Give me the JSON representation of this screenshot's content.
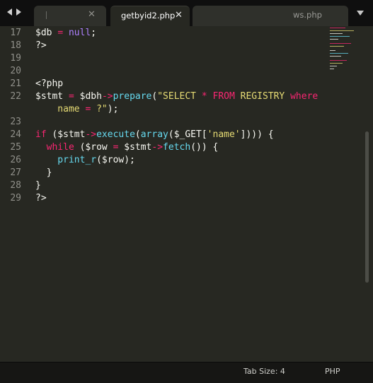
{
  "tabs": [
    {
      "label": "",
      "active": false
    },
    {
      "label": "getbyid2.php",
      "active": true
    },
    {
      "label": "ws.php",
      "active": false
    }
  ],
  "tab_close_glyph": "✕",
  "icons": [
    "nav-back-icon",
    "nav-forward-icon",
    "close-icon",
    "tab-dropdown-icon"
  ],
  "editor": {
    "lines": [
      {
        "num": "17",
        "tokens": [
          [
            "v",
            "$db "
          ],
          [
            "o",
            "="
          ],
          [
            "v",
            " "
          ],
          [
            "p",
            "null"
          ],
          [
            "v",
            ";"
          ]
        ]
      },
      {
        "num": "18",
        "tokens": [
          [
            "v",
            "?>"
          ]
        ]
      },
      {
        "num": "19",
        "tokens": []
      },
      {
        "num": "20",
        "tokens": []
      },
      {
        "num": "21",
        "tokens": [
          [
            "v",
            "<?php"
          ]
        ]
      },
      {
        "num": "22",
        "tokens": [
          [
            "v",
            "$stmt "
          ],
          [
            "o",
            "="
          ],
          [
            "v",
            " $dbh"
          ],
          [
            "o",
            "->"
          ],
          [
            "f",
            "prepare"
          ],
          [
            "v",
            "("
          ],
          [
            "s",
            "\"SELECT "
          ],
          [
            "o",
            "*"
          ],
          [
            "s",
            " "
          ],
          [
            "o",
            "FROM"
          ],
          [
            "s",
            " REGISTRY "
          ],
          [
            "o",
            "where"
          ]
        ]
      },
      {
        "num": "",
        "tokens": [
          [
            "s",
            "    name "
          ],
          [
            "o",
            "="
          ],
          [
            "s",
            " ?\""
          ],
          [
            "v",
            ");"
          ]
        ]
      },
      {
        "num": "23",
        "tokens": []
      },
      {
        "num": "24",
        "tokens": [
          [
            "k",
            "if"
          ],
          [
            "v",
            " ($stmt"
          ],
          [
            "o",
            "->"
          ],
          [
            "f",
            "execute"
          ],
          [
            "v",
            "("
          ],
          [
            "f",
            "array"
          ],
          [
            "v",
            "($_GET["
          ],
          [
            "s",
            "'name'"
          ],
          [
            "v",
            "]))) {"
          ]
        ]
      },
      {
        "num": "25",
        "tokens": [
          [
            "k",
            "  while"
          ],
          [
            "v",
            " ($row "
          ],
          [
            "o",
            "="
          ],
          [
            "v",
            " $stmt"
          ],
          [
            "o",
            "->"
          ],
          [
            "f",
            "fetch"
          ],
          [
            "v",
            "()) {"
          ]
        ]
      },
      {
        "num": "26",
        "tokens": [
          [
            "f",
            "    print_r"
          ],
          [
            "v",
            "($row);"
          ]
        ]
      },
      {
        "num": "27",
        "tokens": [
          [
            "v",
            "  }"
          ]
        ]
      },
      {
        "num": "28",
        "tokens": [
          [
            "v",
            "}"
          ]
        ]
      },
      {
        "num": "29",
        "tokens": [
          [
            "v",
            "?>"
          ]
        ]
      }
    ]
  },
  "colors": {
    "background": "#272822",
    "keyword": "#f92672",
    "function": "#66d9ef",
    "constant": "#ae81ff",
    "string": "#e6db74",
    "text": "#f8f8f2",
    "line_number": "#90908a"
  },
  "status": {
    "tab_size": "Tab Size: 4",
    "syntax": "PHP"
  }
}
